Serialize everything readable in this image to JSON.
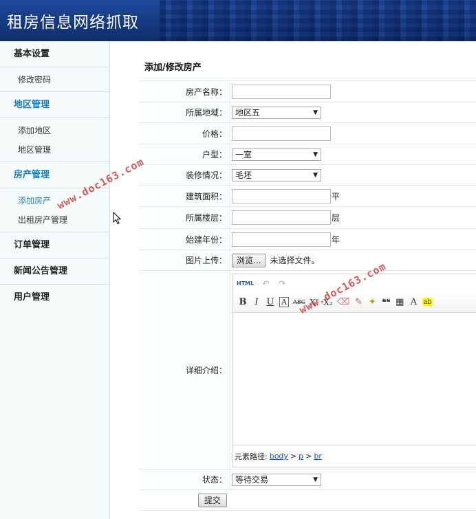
{
  "header": {
    "title": "租房信息网络抓取"
  },
  "sidebar": {
    "groups": [
      {
        "label": "基本设置",
        "items": [
          "修改密码"
        ]
      },
      {
        "label": "地区管理",
        "items": [
          "添加地区",
          "地区管理"
        ]
      },
      {
        "label": "房产管理",
        "items": [
          "添加房产",
          "出租房产管理"
        ]
      },
      {
        "label": "订单管理"
      },
      {
        "label": "新闻公告管理"
      },
      {
        "label": "用户管理"
      }
    ]
  },
  "main": {
    "title": "添加/修改房产",
    "fields": {
      "name": {
        "label": "房产名称：",
        "value": ""
      },
      "region": {
        "label": "所属地域：",
        "value": "地区五"
      },
      "price": {
        "label": "价格：",
        "value": ""
      },
      "layout": {
        "label": "户型：",
        "value": "一室"
      },
      "decor": {
        "label": "装修情况：",
        "value": "毛坯"
      },
      "area": {
        "label": "建筑面积：",
        "value": "",
        "unit": "平"
      },
      "floor": {
        "label": "所属楼层：",
        "value": "",
        "unit": "层"
      },
      "year": {
        "label": "始建年份：",
        "value": "",
        "unit": "年"
      },
      "image": {
        "label": "图片上传：",
        "button": "浏览...",
        "status": "未选择文件。"
      },
      "detail": {
        "label": "详细介绍："
      },
      "status": {
        "label": "状态：",
        "value": "等待交易"
      }
    },
    "editor": {
      "path_label": "元素路径:",
      "path": [
        "body",
        "p",
        "br"
      ],
      "path_sep": ">",
      "toolbar1": [
        "HTML",
        "↶",
        "↷"
      ],
      "toolbar2": [
        "B",
        "I",
        "U",
        "A",
        "ABC",
        "X²",
        "X₂",
        "⌫",
        "✎",
        "✦",
        "❝❝",
        "▦",
        "A",
        "ab"
      ]
    },
    "submit_label": "提交"
  },
  "watermark": "www.doc163.com"
}
